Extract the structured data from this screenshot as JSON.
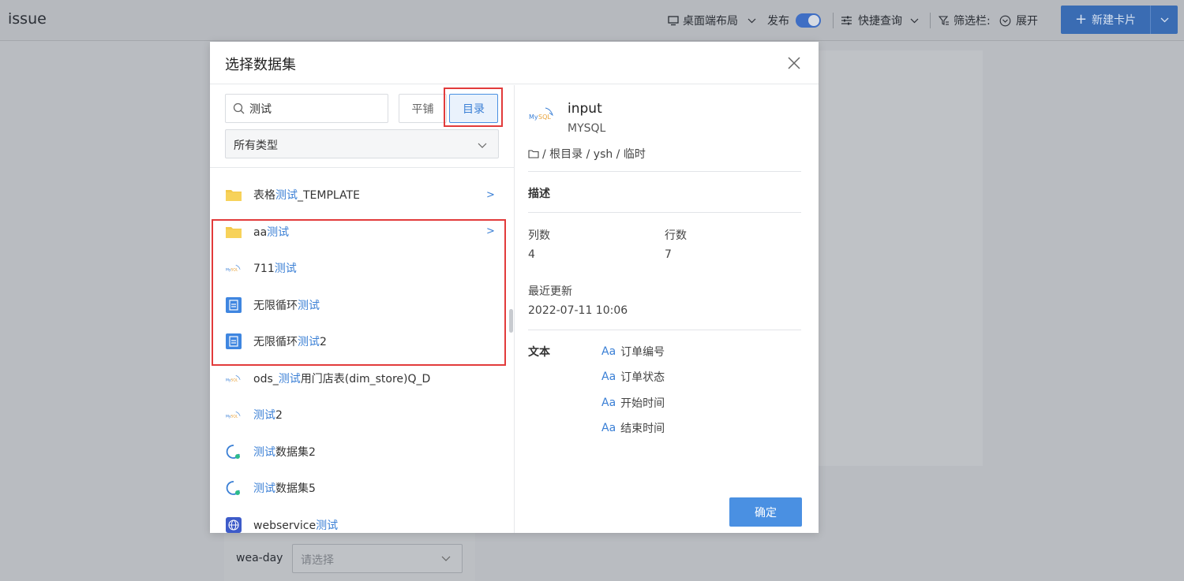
{
  "app": {
    "title": "issue"
  },
  "toolbar": {
    "layout_label": "桌面端布局",
    "publish_label": "发布",
    "quick_query_label": "快捷查询",
    "filter_label": "筛选栏:",
    "expand_label": "展开",
    "new_card_label": "新建卡片"
  },
  "background": {
    "field_label": "wea-day",
    "select_placeholder": "请选择"
  },
  "dialog": {
    "title": "选择数据集",
    "search": {
      "value": "测试"
    },
    "view_toggle": {
      "flat_label": "平铺",
      "dir_label": "目录",
      "selected": "目录"
    },
    "type_select": {
      "value": "所有类型"
    },
    "items": [
      {
        "icon": "folder-icon",
        "prefix": "表格",
        "highlight": "测试",
        "suffix": "_TEMPLATE",
        "has_children": true
      },
      {
        "icon": "folder-icon",
        "prefix": "aa",
        "highlight": "测试",
        "suffix": "",
        "has_children": true
      },
      {
        "icon": "mysql-icon",
        "prefix": "711",
        "highlight": "测试",
        "suffix": "",
        "has_children": false
      },
      {
        "icon": "table-doc-icon",
        "prefix": "无限循环",
        "highlight": "测试",
        "suffix": "",
        "has_children": false
      },
      {
        "icon": "table-doc-icon",
        "prefix": "无限循环",
        "highlight": "测试",
        "suffix": "2",
        "has_children": false
      },
      {
        "icon": "mysql-icon",
        "prefix": "ods_",
        "highlight": "测试",
        "suffix": "用门店表(dim_store)Q_D",
        "has_children": false
      },
      {
        "icon": "mysql-icon",
        "prefix": "",
        "highlight": "测试",
        "suffix": "2",
        "has_children": false
      },
      {
        "icon": "self-service-dataset-icon",
        "prefix": "",
        "highlight": "测试",
        "suffix": "数据集2",
        "has_children": false
      },
      {
        "icon": "self-service-dataset-icon",
        "prefix": "",
        "highlight": "测试",
        "suffix": "数据集5",
        "has_children": false
      },
      {
        "icon": "webservice-icon",
        "prefix": "webservice",
        "highlight": "测试",
        "suffix": "",
        "has_children": false
      }
    ],
    "detail": {
      "name": "input",
      "source_type": "MYSQL",
      "path": "/ 根目录 / ysh / 临时",
      "description_heading": "描述",
      "columns_label": "列数",
      "columns_value": "4",
      "rows_label": "行数",
      "rows_value": "7",
      "updated_label": "最近更新",
      "updated_value": "2022-07-11 10:06",
      "text_heading": "文本",
      "fields": [
        "订单编号",
        "订单状态",
        "开始时间",
        "结束时间"
      ],
      "field_type_glyph": "Aa"
    },
    "confirm_label": "确定"
  },
  "colors": {
    "accent": "#4a90e2",
    "highlight_box": "#e23b3b",
    "folder": "#f3c94b"
  }
}
